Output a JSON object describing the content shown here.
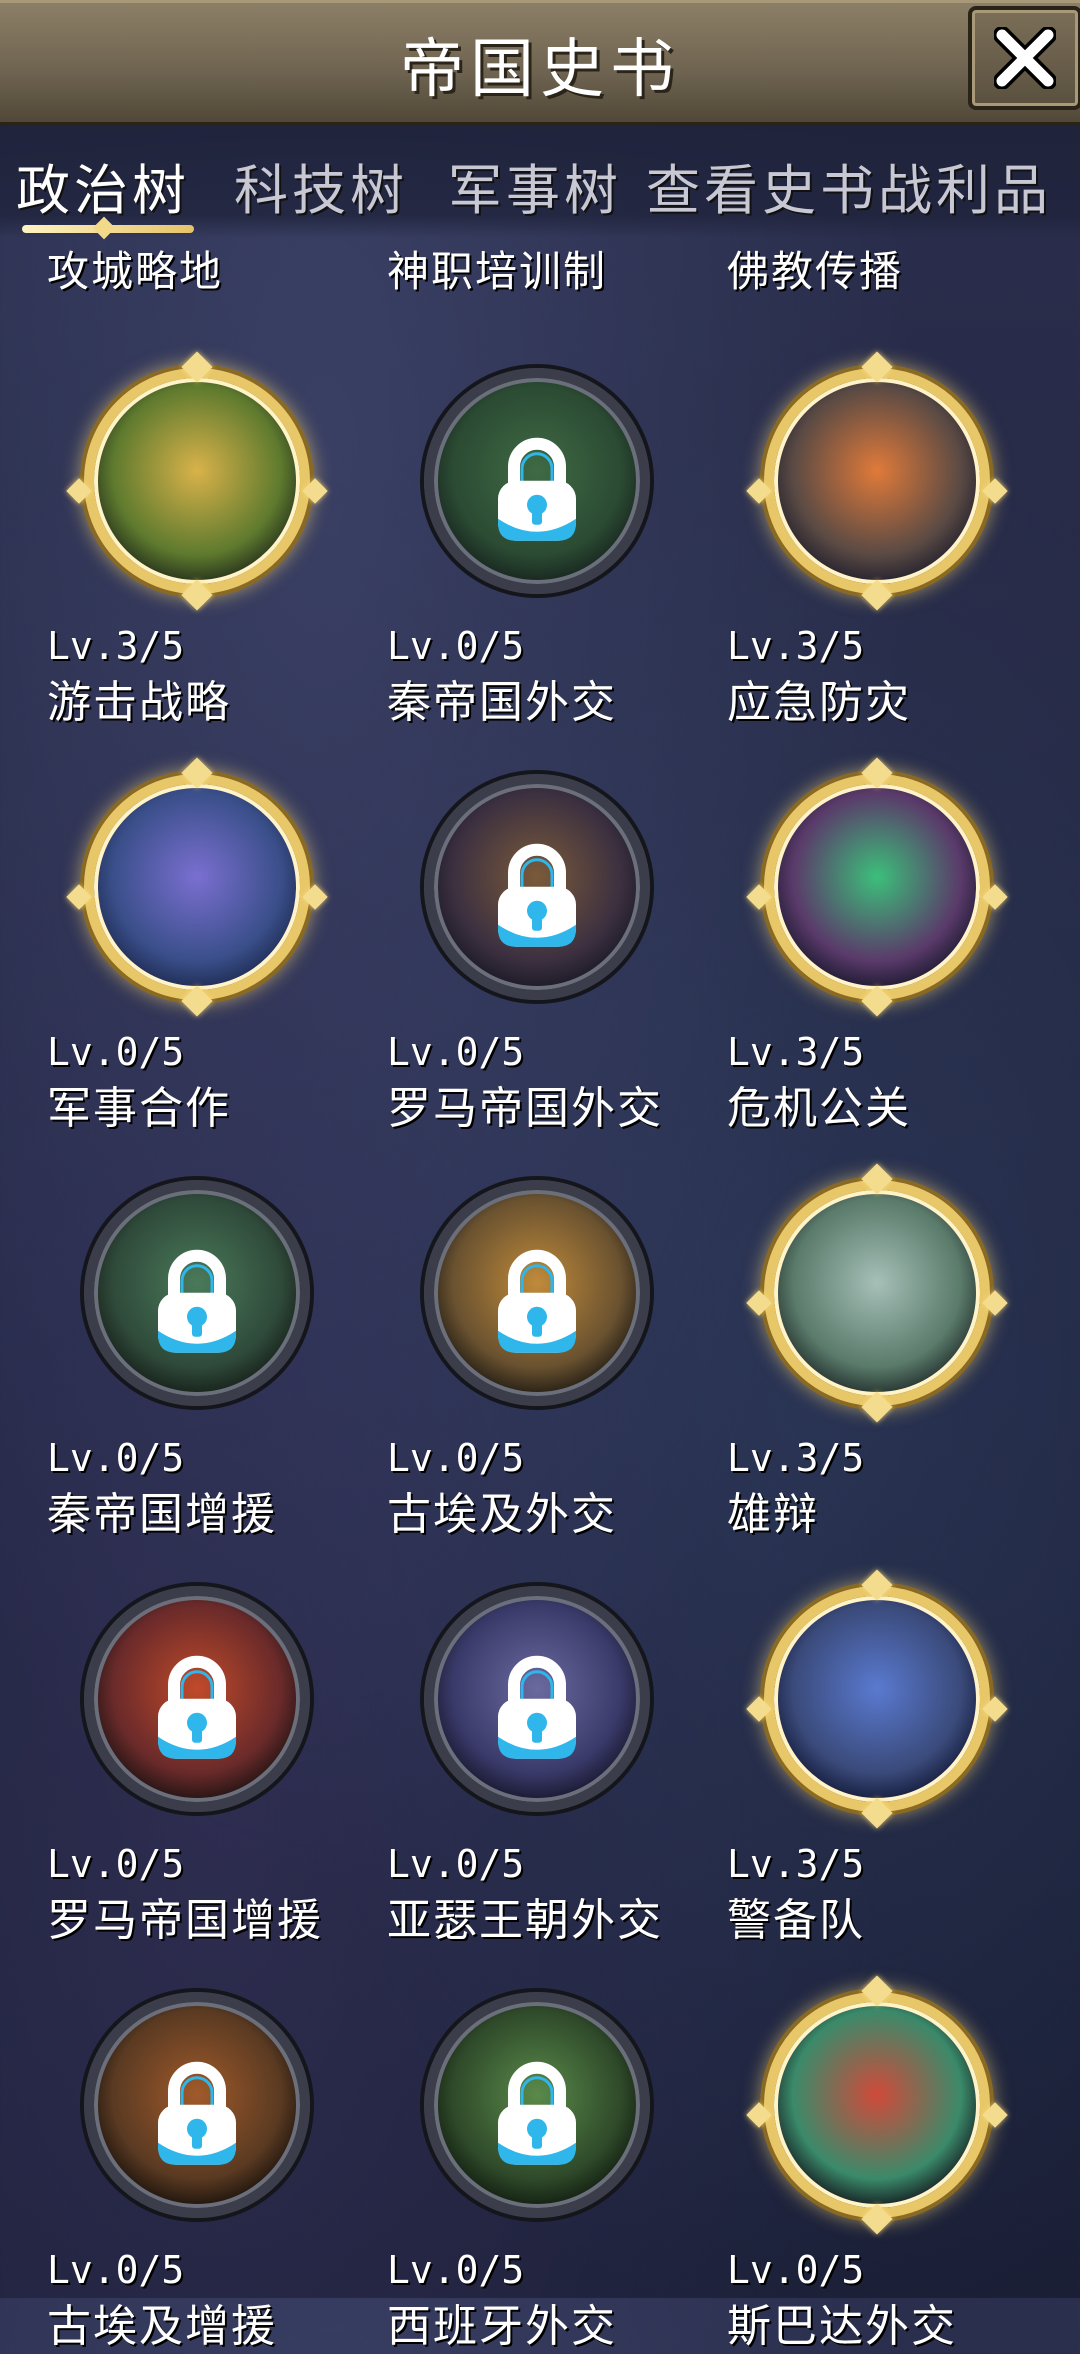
{
  "header": {
    "title": "帝国史书",
    "close_icon": "close-icon"
  },
  "tabs": [
    {
      "label": "政治树",
      "active": true
    },
    {
      "label": "科技树",
      "active": false
    },
    {
      "label": "军事树",
      "active": false
    },
    {
      "label": "查看史书战利品",
      "active": false
    }
  ],
  "top_row_labels": [
    "攻城略地",
    "神职培训制",
    "佛教传播"
  ],
  "skills": [
    {
      "level": "Lv.3/5",
      "name": "游击战略",
      "unlocked": true
    },
    {
      "level": "Lv.0/5",
      "name": "秦帝国外交",
      "unlocked": false
    },
    {
      "level": "Lv.3/5",
      "name": "应急防灾",
      "unlocked": true
    },
    {
      "level": "Lv.0/5",
      "name": "军事合作",
      "unlocked": true
    },
    {
      "level": "Lv.0/5",
      "name": "罗马帝国外交",
      "unlocked": false
    },
    {
      "level": "Lv.3/5",
      "name": "危机公关",
      "unlocked": true
    },
    {
      "level": "Lv.0/5",
      "name": "秦帝国增援",
      "unlocked": false
    },
    {
      "level": "Lv.0/5",
      "name": "古埃及外交",
      "unlocked": false
    },
    {
      "level": "Lv.3/5",
      "name": "雄辩",
      "unlocked": true
    },
    {
      "level": "Lv.0/5",
      "name": "罗马帝国增援",
      "unlocked": false
    },
    {
      "level": "Lv.0/5",
      "name": "亚瑟王朝外交",
      "unlocked": false
    },
    {
      "level": "Lv.3/5",
      "name": "警备队",
      "unlocked": true
    },
    {
      "level": "Lv.0/5",
      "name": "古埃及增援",
      "unlocked": false
    },
    {
      "level": "Lv.0/5",
      "name": "西班牙外交",
      "unlocked": false
    },
    {
      "level": "Lv.0/5",
      "name": "斯巴达外交",
      "unlocked": true
    }
  ],
  "colors": {
    "gold_frame": "#e8c769",
    "locked_frame": "#3b3e4a",
    "lock_body": "#ffffff",
    "lock_accent": "#2fb6ea"
  }
}
